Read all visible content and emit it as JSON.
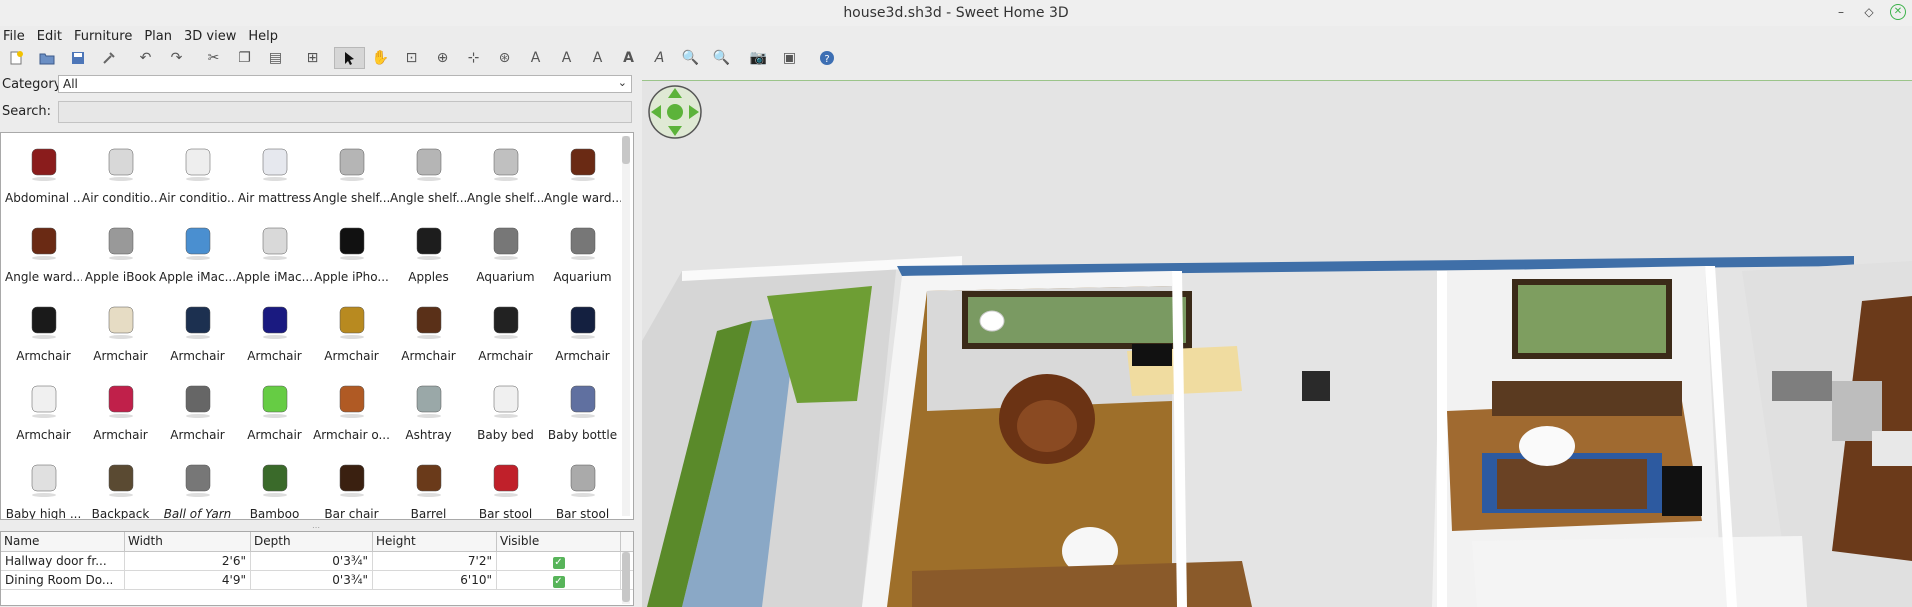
{
  "window": {
    "title": "house3d.sh3d - Sweet Home 3D"
  },
  "menu": [
    "File",
    "Edit",
    "Furniture",
    "Plan",
    "3D view",
    "Help"
  ],
  "toolbar": {
    "icons": [
      "new-home-icon",
      "open-icon",
      "save-icon",
      "preferences-icon",
      "undo-icon",
      "redo-icon",
      "cut-icon",
      "copy-icon",
      "paste-icon",
      "add-furniture-icon",
      "select-icon",
      "pan-icon",
      "create-walls-icon",
      "create-rooms-icon",
      "create-polylines-icon",
      "create-dimensions-icon",
      "add-text-icon",
      "text-style-1-icon",
      "text-style-2-icon",
      "text-style-3-icon",
      "text-style-4-icon",
      "zoom-in-icon",
      "zoom-out-icon",
      "photo-icon",
      "video-icon",
      "help-icon"
    ]
  },
  "catalog": {
    "category_label": "Category:",
    "category_value": "All",
    "search_label": "Search:",
    "search_value": "",
    "items": [
      {
        "label": "Abdominal ...",
        "icon": "bench-icon"
      },
      {
        "label": "Air conditio...",
        "icon": "ac-outdoor-icon"
      },
      {
        "label": "Air conditio...",
        "icon": "ac-indoor-icon"
      },
      {
        "label": "Air mattress",
        "icon": "mattress-icon"
      },
      {
        "label": "Angle shelf...",
        "icon": "shelf-icon"
      },
      {
        "label": "Angle shelf...",
        "icon": "shelf-icon"
      },
      {
        "label": "Angle shelf...",
        "icon": "corner-shelf-icon"
      },
      {
        "label": "Angle ward...",
        "icon": "wardrobe-icon"
      },
      {
        "label": "Angle ward...",
        "icon": "wardrobe-icon"
      },
      {
        "label": "Apple iBook",
        "icon": "laptop-icon"
      },
      {
        "label": "Apple iMac...",
        "icon": "imac-icon"
      },
      {
        "label": "Apple iMac...",
        "icon": "imac-keyboard-icon"
      },
      {
        "label": "Apple iPho...",
        "icon": "phone-icon"
      },
      {
        "label": "Apples",
        "icon": "apples-icon"
      },
      {
        "label": "Aquarium",
        "icon": "aquarium-icon"
      },
      {
        "label": "Aquarium",
        "icon": "aquarium-icon"
      },
      {
        "label": "Armchair",
        "icon": "armchair-black-icon"
      },
      {
        "label": "Armchair",
        "icon": "armchair-cream-icon"
      },
      {
        "label": "Armchair",
        "icon": "armchair-navy-icon"
      },
      {
        "label": "Armchair",
        "icon": "armchair-blue-icon"
      },
      {
        "label": "Armchair",
        "icon": "armchair-gold-icon"
      },
      {
        "label": "Armchair",
        "icon": "armchair-brown-icon"
      },
      {
        "label": "Armchair",
        "icon": "armchair-chrome-icon"
      },
      {
        "label": "Armchair",
        "icon": "armchair-darkblue-icon"
      },
      {
        "label": "Armchair",
        "icon": "armchair-white-icon"
      },
      {
        "label": "Armchair",
        "icon": "armchair-red-icon"
      },
      {
        "label": "Armchair",
        "icon": "armchair-gray-icon"
      },
      {
        "label": "Armchair",
        "icon": "armchair-green-icon"
      },
      {
        "label": "Armchair o...",
        "icon": "lounge-chair-icon"
      },
      {
        "label": "Ashtray",
        "icon": "ashtray-icon"
      },
      {
        "label": "Baby bed",
        "icon": "baby-bed-icon"
      },
      {
        "label": "Baby bottle",
        "icon": "baby-bottle-icon"
      },
      {
        "label": "Baby high ...",
        "icon": "high-chair-icon"
      },
      {
        "label": "Backpack",
        "icon": "backpack-icon"
      },
      {
        "label": "Ball of Yarn",
        "icon": "yarn-icon",
        "italic": true
      },
      {
        "label": "Bamboo",
        "icon": "bamboo-icon"
      },
      {
        "label": "Bar chair",
        "icon": "bar-chair-icon"
      },
      {
        "label": "Barrel",
        "icon": "barrel-icon"
      },
      {
        "label": "Bar stool",
        "icon": "bar-stool-red-icon"
      },
      {
        "label": "Bar stool",
        "icon": "bar-stool-gray-icon"
      }
    ]
  },
  "furniture_table": {
    "columns": [
      "Name",
      "Width",
      "Depth",
      "Height",
      "Visible"
    ],
    "rows": [
      {
        "name": "Hallway door fr...",
        "width": "2'6\"",
        "depth": "0'3¾\"",
        "height": "7'2\"",
        "visible": true
      },
      {
        "name": "Dining Room Do...",
        "width": "4'9\"",
        "depth": "0'3¾\"",
        "height": "6'10\"",
        "visible": true
      }
    ]
  }
}
